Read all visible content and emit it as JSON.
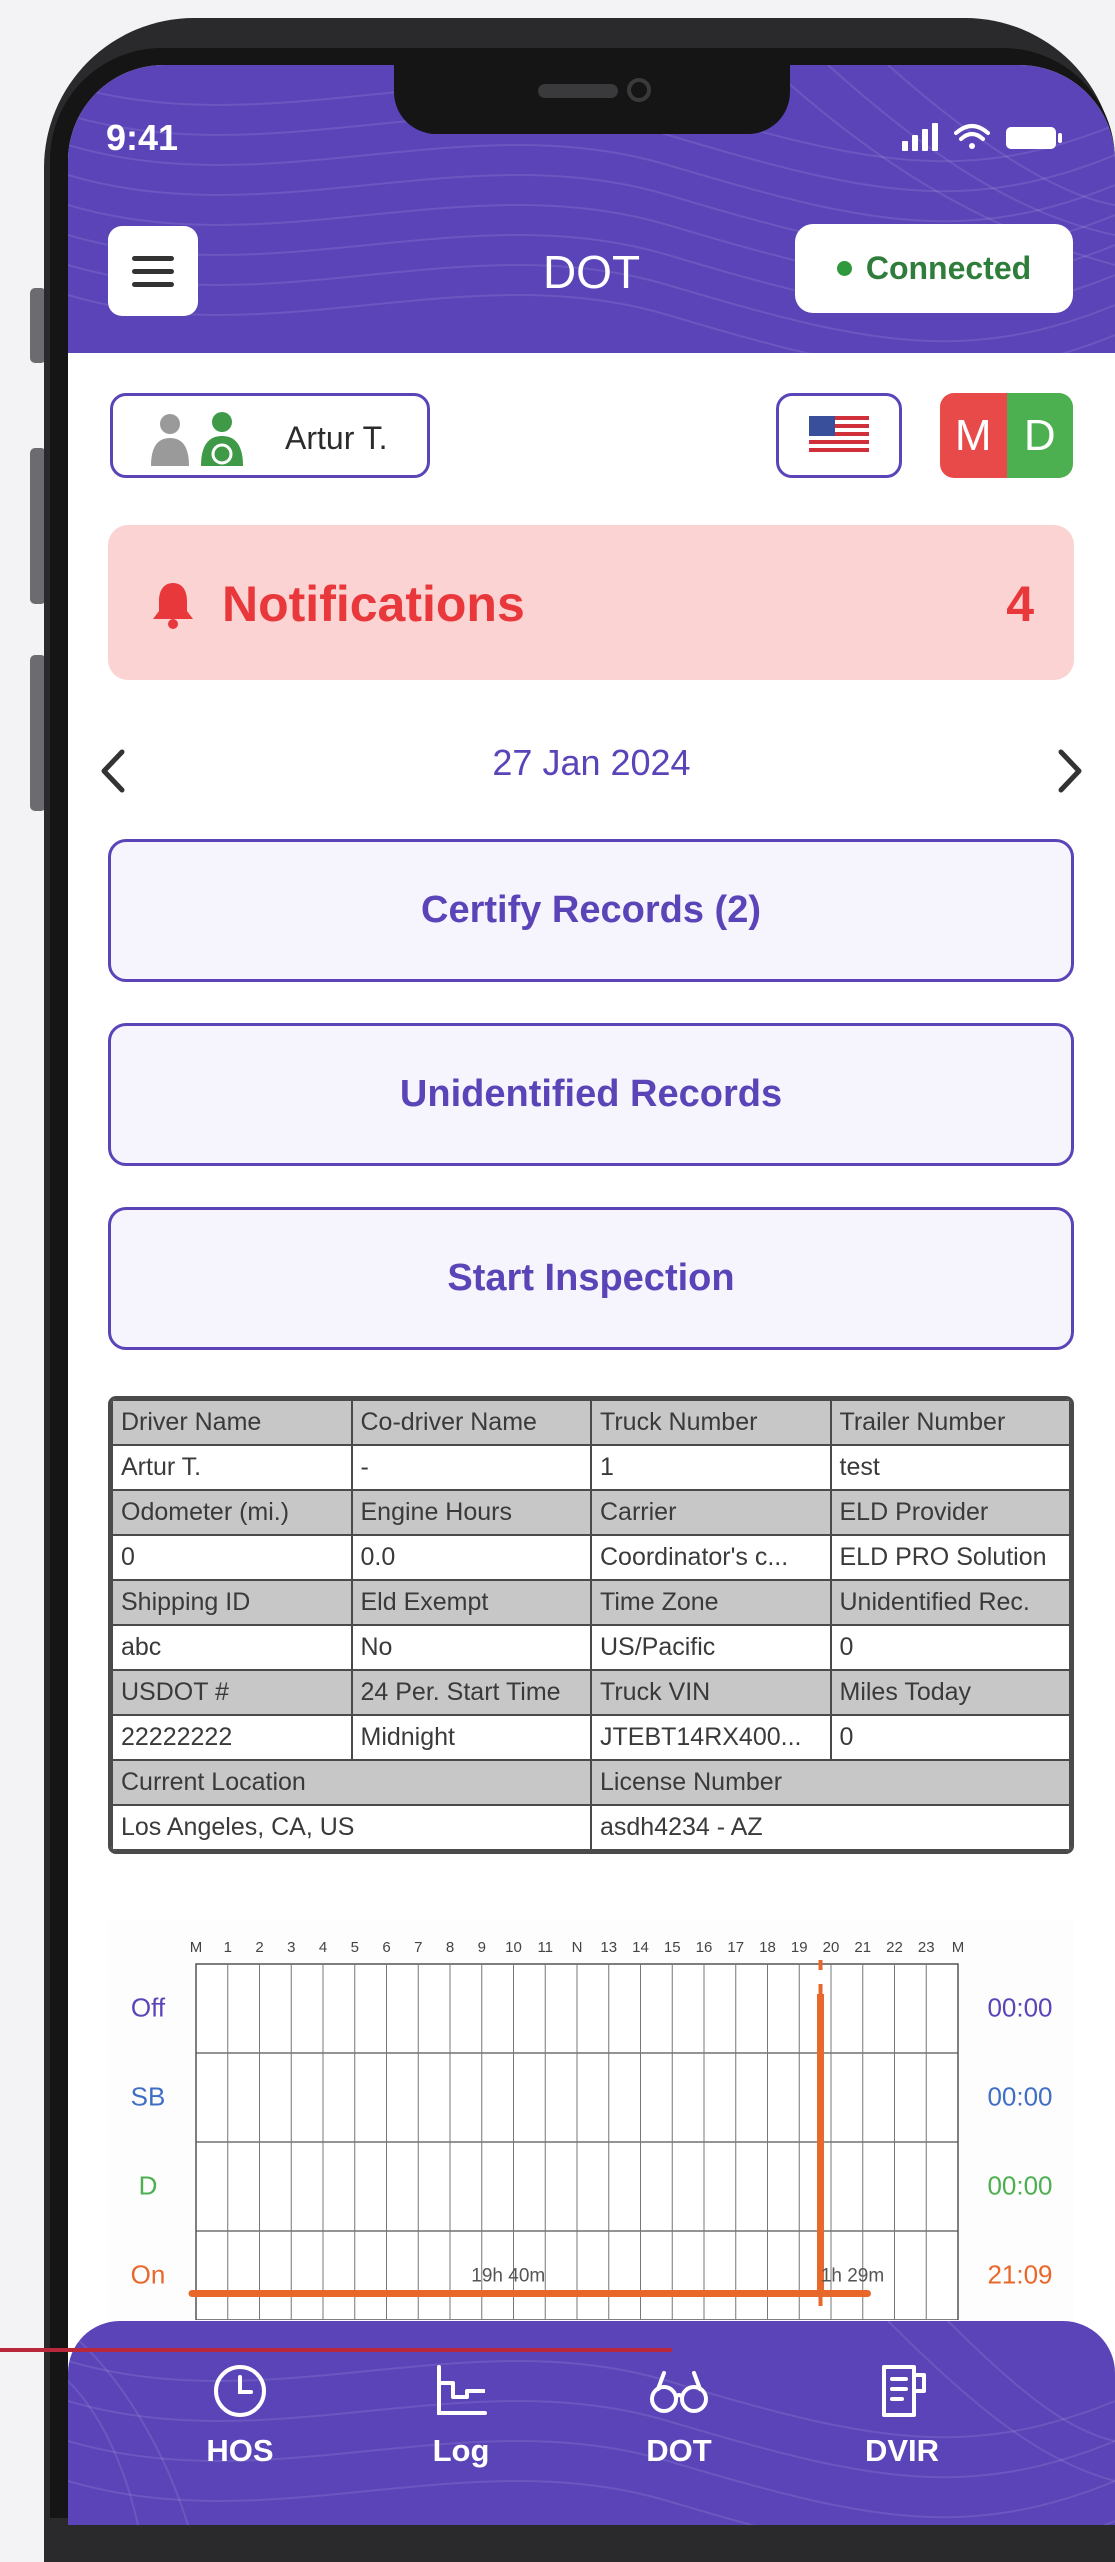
{
  "status_bar": {
    "time": "9:41"
  },
  "header": {
    "title": "DOT",
    "connection_label": "Connected"
  },
  "driver": {
    "name": "Artur T."
  },
  "duty_badge": {
    "left": "M",
    "right": "D",
    "left_color": "#e84a4a",
    "right_color": "#4caf50"
  },
  "notifications": {
    "label": "Notifications",
    "count": "4"
  },
  "date_nav": {
    "date": "27 Jan 2024"
  },
  "actions": {
    "certify": "Certify Records (2)",
    "unidentified": "Unidentified Records",
    "inspection": "Start Inspection"
  },
  "info_table": {
    "rows": [
      {
        "headers": [
          "Driver Name",
          "Co-driver Name",
          "Truck Number",
          "Trailer Number"
        ],
        "values": [
          "Artur T.",
          "-",
          "1",
          "test"
        ]
      },
      {
        "headers": [
          "Odometer (mi.)",
          "Engine Hours",
          "Carrier",
          "ELD Provider"
        ],
        "values": [
          "0",
          "0.0",
          "Coordinator's c...",
          "ELD PRO Solution"
        ]
      },
      {
        "headers": [
          "Shipping ID",
          "Eld Exempt",
          "Time Zone",
          "Unidentified Rec."
        ],
        "values": [
          "abc",
          "No",
          "US/Pacific",
          "0"
        ]
      },
      {
        "headers": [
          "USDOT #",
          "24 Per. Start Time",
          "Truck VIN",
          "Miles Today"
        ],
        "values": [
          "22222222",
          "Midnight",
          "JTEBT14RX400...",
          "0"
        ]
      }
    ],
    "location": {
      "headers": [
        "Current Location",
        "License Number"
      ],
      "values": [
        "Los Angeles, CA, US",
        "asdh4234  -  AZ"
      ]
    }
  },
  "log_graph": {
    "hour_labels": [
      "M",
      "1",
      "2",
      "3",
      "4",
      "5",
      "6",
      "7",
      "8",
      "9",
      "10",
      "11",
      "N",
      "13",
      "14",
      "15",
      "16",
      "17",
      "18",
      "19",
      "20",
      "21",
      "22",
      "23",
      "M"
    ],
    "rows": [
      {
        "label": "Off",
        "total": "00:00",
        "color": "#5b44b8"
      },
      {
        "label": "SB",
        "total": "00:00",
        "color": "#3f6fc4"
      },
      {
        "label": "D",
        "total": "00:00",
        "color": "#4caf50"
      },
      {
        "label": "On",
        "total": "21:09",
        "color": "#e8672a"
      }
    ],
    "line_color": "#e8672a",
    "segments": [
      {
        "status": "On",
        "start_hour": 0,
        "end_hour": 19.67,
        "duration_label": "19h 40m"
      },
      {
        "status": "On",
        "start_hour": 19.67,
        "end_hour": 21.15,
        "duration_label": "1h 29m"
      }
    ],
    "current_hour": 19.67
  },
  "tabs": [
    {
      "label": "HOS",
      "icon": "clock-icon"
    },
    {
      "label": "Log",
      "icon": "chart-step-icon"
    },
    {
      "label": "DOT",
      "icon": "glasses-icon"
    },
    {
      "label": "DVIR",
      "icon": "report-icon"
    }
  ],
  "colors": {
    "primary": "#5b44b8",
    "danger": "#e8383c",
    "notif_bg": "#fcd3d3",
    "connected": "#2f9a3c"
  }
}
